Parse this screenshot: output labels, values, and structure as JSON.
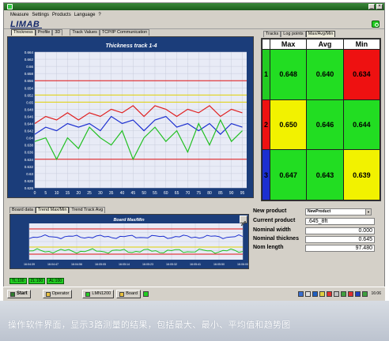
{
  "menu": [
    "Measure",
    "Settings",
    "Products",
    "Language",
    "?"
  ],
  "window_buttons": [
    "_",
    "×"
  ],
  "brand": "LIMAB",
  "top_tabs": [
    "Thickness",
    "Profile",
    "3D",
    "Track Values",
    "TCP/IP Communication"
  ],
  "right_tabs": [
    "Tracks",
    "Log points",
    "Max/Avg/Min"
  ],
  "chart_data": {
    "type": "line",
    "title": "Thickness track 1-4",
    "xlabel": "",
    "ylabel": "",
    "x": [
      0,
      5,
      10,
      15,
      20,
      25,
      30,
      35,
      40,
      45,
      50,
      55,
      60,
      65,
      70,
      75,
      80,
      85,
      90,
      95
    ],
    "xlim": [
      0,
      97
    ],
    "ylim": [
      0.626,
      0.664
    ],
    "yticks": [
      0.664,
      0.662,
      0.66,
      0.658,
      0.656,
      0.654,
      0.652,
      0.65,
      0.648,
      0.646,
      0.644,
      0.642,
      0.64,
      0.638,
      0.636,
      0.634,
      0.632,
      0.63,
      0.628,
      0.626
    ],
    "xticks": [
      0,
      5,
      10,
      15,
      20,
      25,
      30,
      35,
      40,
      45,
      50,
      55,
      60,
      65,
      70,
      75,
      80,
      85,
      90,
      95
    ],
    "reference_lines": [
      {
        "y": 0.656,
        "color": "#e01010"
      },
      {
        "y": 0.652,
        "color": "#e0d000"
      },
      {
        "y": 0.65,
        "color": "#e0d000"
      },
      {
        "y": 0.634,
        "color": "#e01010"
      }
    ],
    "series": [
      {
        "color": "#e02020",
        "values": [
          0.644,
          0.646,
          0.645,
          0.647,
          0.645,
          0.647,
          0.646,
          0.648,
          0.647,
          0.649,
          0.646,
          0.649,
          0.648,
          0.646,
          0.648,
          0.647,
          0.649,
          0.646,
          0.648,
          0.647
        ]
      },
      {
        "color": "#1c2fd0",
        "values": [
          0.641,
          0.643,
          0.642,
          0.644,
          0.643,
          0.644,
          0.642,
          0.646,
          0.644,
          0.645,
          0.642,
          0.645,
          0.646,
          0.643,
          0.644,
          0.642,
          0.644,
          0.641,
          0.644,
          0.643
        ]
      },
      {
        "color": "#22c022",
        "values": [
          0.639,
          0.64,
          0.634,
          0.64,
          0.637,
          0.643,
          0.64,
          0.638,
          0.642,
          0.634,
          0.64,
          0.643,
          0.639,
          0.642,
          0.636,
          0.644,
          0.638,
          0.645,
          0.639,
          0.642
        ]
      }
    ]
  },
  "table": {
    "headers": [
      "",
      "Max",
      "Avg",
      "Min"
    ],
    "rows": [
      {
        "index": "1",
        "index_color": "#22cc22",
        "cells": [
          {
            "value": "0.648",
            "color": "#22dd22"
          },
          {
            "value": "0.640",
            "color": "#22dd22"
          },
          {
            "value": "0.634",
            "color": "#ee1111"
          }
        ]
      },
      {
        "index": "2",
        "index_color": "#ee1111",
        "cells": [
          {
            "value": "0.650",
            "color": "#f2f200"
          },
          {
            "value": "0.646",
            "color": "#22dd22"
          },
          {
            "value": "0.644",
            "color": "#22dd22"
          }
        ]
      },
      {
        "index": "3",
        "index_color": "#1c2fd0",
        "cells": [
          {
            "value": "0.647",
            "color": "#22dd22"
          },
          {
            "value": "0.643",
            "color": "#22dd22"
          },
          {
            "value": "0.639",
            "color": "#f2f200"
          }
        ]
      }
    ]
  },
  "bottom_tabs": [
    "Board data",
    "Trend Max/Min",
    "Trend Track Avg"
  ],
  "trend": {
    "title": "Board Max/Min",
    "times": [
      "16:04:39",
      "16:04:47",
      "16:04:56",
      "16:05:05",
      "16:05:14",
      "16:05:23",
      "16:05:32",
      "16:05:41",
      "16:05:50",
      "16:06:00"
    ]
  },
  "info": {
    "new_product_label": "New product",
    "new_product_value": "NewProduct",
    "current_product_label": "Current product",
    "current_product_value": ".645_8ft",
    "nominal_width_label": "Nominal width",
    "nominal_width_value": "0.000",
    "nominal_thickness_label": "Nominal thicknes",
    "nominal_thickness_value": "0.645",
    "nom_length_label": "Nom length",
    "nom_length_value": "97.480"
  },
  "status_boxes": [
    "TL:100",
    "ZL:100",
    "AL:100"
  ],
  "taskbar": {
    "start": "Start",
    "apps": [
      "Operator",
      "LMN1200",
      "Board"
    ],
    "clock": "16:06"
  },
  "caption": "操作软件界面，显示3路测量的结果，包括最大、最小、平均值和趋势图"
}
